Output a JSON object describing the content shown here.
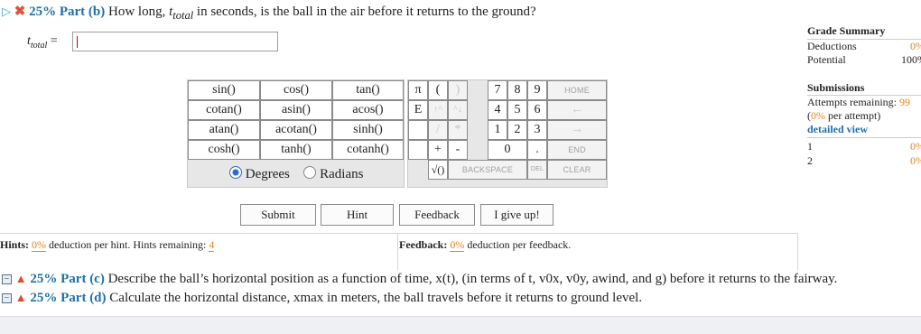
{
  "part_b": {
    "percent": "25%",
    "part_label": "Part (b)",
    "question": "How long, ",
    "var_main": "t",
    "var_sub": "total",
    "question_end": " in seconds, is the ball in the air before it returns to the ground?"
  },
  "answer": {
    "label_main": "t",
    "label_sub": "total",
    "equals": "=",
    "value": ""
  },
  "keypad": {
    "functions": [
      [
        "sin()",
        "cos()",
        "tan()"
      ],
      [
        "cotan()",
        "asin()",
        "acos()"
      ],
      [
        "atan()",
        "acotan()",
        "sinh()"
      ],
      [
        "cosh()",
        "tanh()",
        "cotanh()"
      ]
    ],
    "degrees": "Degrees",
    "radians": "Radians",
    "pi": "π",
    "e": "E",
    "lparen": "(",
    "rparen": ")",
    "up": "↑^",
    "down": "^↓",
    "slash": "/",
    "star": "*",
    "plus": "+",
    "minus": "-",
    "sqrt": "√()",
    "digits": [
      "7",
      "8",
      "9",
      "4",
      "5",
      "6",
      "1",
      "2",
      "3",
      "0",
      "."
    ],
    "home": "HOME",
    "left_arrow": "←",
    "right_arrow": "→",
    "end": "END",
    "backspace": "BACKSPACE",
    "del": "DEL",
    "clear": "CLEAR"
  },
  "actions": {
    "submit": "Submit",
    "hint": "Hint",
    "feedback": "Feedback",
    "give_up": "I give up!"
  },
  "hints": {
    "label": "Hints:",
    "pct": "0%",
    "text": "deduction per hint. Hints remaining:",
    "remaining": "4"
  },
  "feedback": {
    "label": "Feedback:",
    "pct": "0%",
    "text": "deduction per feedback."
  },
  "grade_summary": {
    "title": "Grade Summary",
    "deductions_label": "Deductions",
    "deductions_value": "0%",
    "potential_label": "Potential",
    "potential_value": "100%",
    "submissions_title": "Submissions",
    "attempts_label": "Attempts remaining:",
    "attempts_value": "99",
    "per_attempt_open": "(",
    "per_attempt_pct": "0%",
    "per_attempt_close": " per attempt)",
    "detailed_view": "detailed view",
    "rows": [
      {
        "n": "1",
        "v": "0%"
      },
      {
        "n": "2",
        "v": "0%"
      }
    ]
  },
  "part_c": {
    "percent": "25%",
    "label": "Part (c)",
    "text": "Describe the ball’s horizontal position as a function of time, x(t), (in terms of t, v0x, v0y, awind, and g) before it returns to the fairway."
  },
  "part_d": {
    "percent": "25%",
    "label": "Part (d)",
    "text": "Calculate the horizontal distance, xmax in meters, the ball travels before it returns to ground level."
  },
  "colors": {
    "accent": "#1f6fa8",
    "orange": "#e8821f",
    "error": "#e0533b"
  }
}
